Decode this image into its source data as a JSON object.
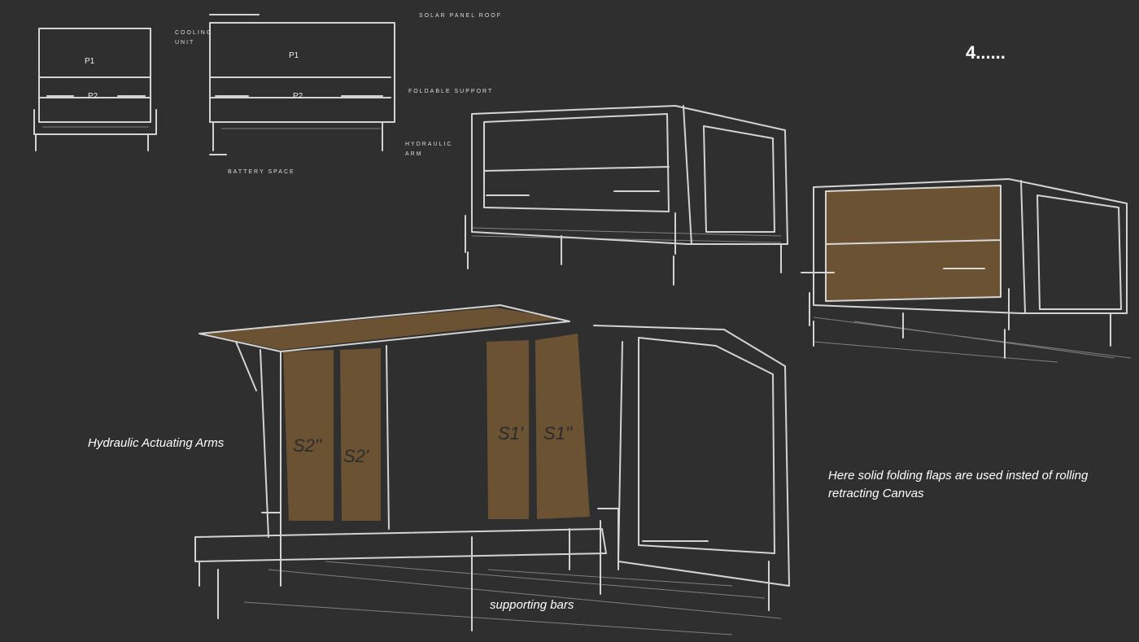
{
  "heading": "4......",
  "sketch_labels": {
    "cooling_unit": "Cooling unit",
    "solar_panel_roof": "Solar panel roof",
    "foldable_support": "Foldable support",
    "hydraulic_arm": "Hydraulic arm",
    "battery_space": "Battery space",
    "p1_left": "P1",
    "p2_left": "P2",
    "p1_right": "P1",
    "p2_right": "P2"
  },
  "panel_labels": [
    "S2''",
    "S2'",
    "S1'",
    "S1''"
  ],
  "annotations": {
    "hydraulic": "Hydraulic Actuating Arms",
    "flaps": "Here solid folding flaps are used insted of rolling retracting Canvas",
    "supporting": "supporting bars"
  },
  "colors": {
    "background": "#2f2f2f",
    "flap": "#6e5434",
    "line": "#e6e6e6"
  }
}
